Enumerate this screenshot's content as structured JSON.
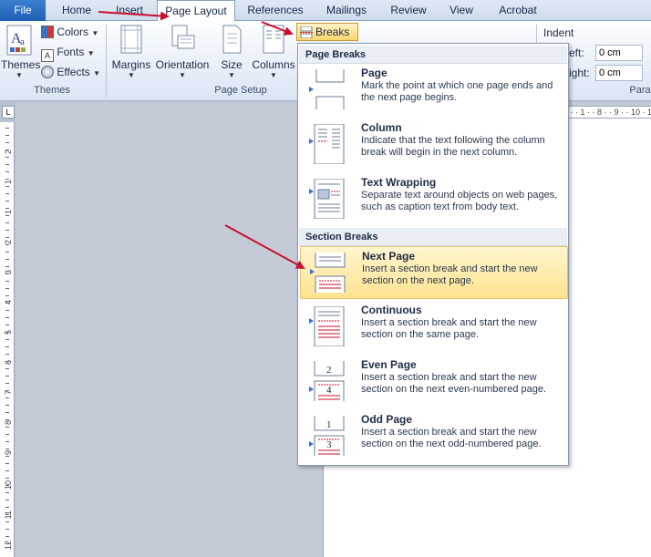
{
  "tabs": [
    "File",
    "Home",
    "Insert",
    "Page Layout",
    "References",
    "Mailings",
    "Review",
    "View",
    "Acrobat"
  ],
  "ribbon": {
    "themes": {
      "button": "Themes",
      "colors": "Colors",
      "fonts": "Fonts",
      "effects": "Effects",
      "group_label": "Themes"
    },
    "page_setup": {
      "margins": "Margins",
      "orientation": "Orientation",
      "size": "Size",
      "columns": "Columns",
      "breaks": "Breaks",
      "group_label": "Page Setup"
    },
    "paragraph": {
      "indent_label": "Indent",
      "left_label": "eft:",
      "right_label": "ight:",
      "left_value": "0 cm",
      "right_value": "0 cm",
      "group_label": "Para"
    }
  },
  "ruler": {
    "corner": "L",
    "horizontal": "· ·  ·  1 ·  · 8 ·  · 9 ·  · 10 · 1",
    "vertical_numbers": [
      "2",
      "1",
      "1",
      "2",
      "3",
      "4",
      "5",
      "6",
      "7",
      "8",
      "9",
      "10",
      "11",
      "12"
    ]
  },
  "menu": {
    "page_breaks_header": "Page Breaks",
    "section_breaks_header": "Section Breaks",
    "items": [
      {
        "title": "Page",
        "description": "Mark the point at which one page ends and the next page begins."
      },
      {
        "title": "Column",
        "description": "Indicate that the text following the column break will begin in the next column."
      },
      {
        "title": "Text Wrapping",
        "description": "Separate text around objects on web pages, such as caption text from body text."
      },
      {
        "title": "Next Page",
        "description": "Insert a section break and start the new section on the next page."
      },
      {
        "title": "Continuous",
        "description": "Insert a section break and start the new section on the same page."
      },
      {
        "title": "Even Page",
        "description": "Insert a section break and start the new section on the next even-numbered page."
      },
      {
        "title": "Odd Page",
        "description": "Insert a section break and start the new section on the next odd-numbered page."
      }
    ],
    "even_icon_numbers": [
      "2",
      "4"
    ],
    "odd_icon_numbers": [
      "1",
      "3"
    ],
    "highlighted": "Next Page"
  },
  "colors": {
    "accent": "#c8102e",
    "highlight": "#ffe38f",
    "file_tab": "#2a6cc3"
  }
}
